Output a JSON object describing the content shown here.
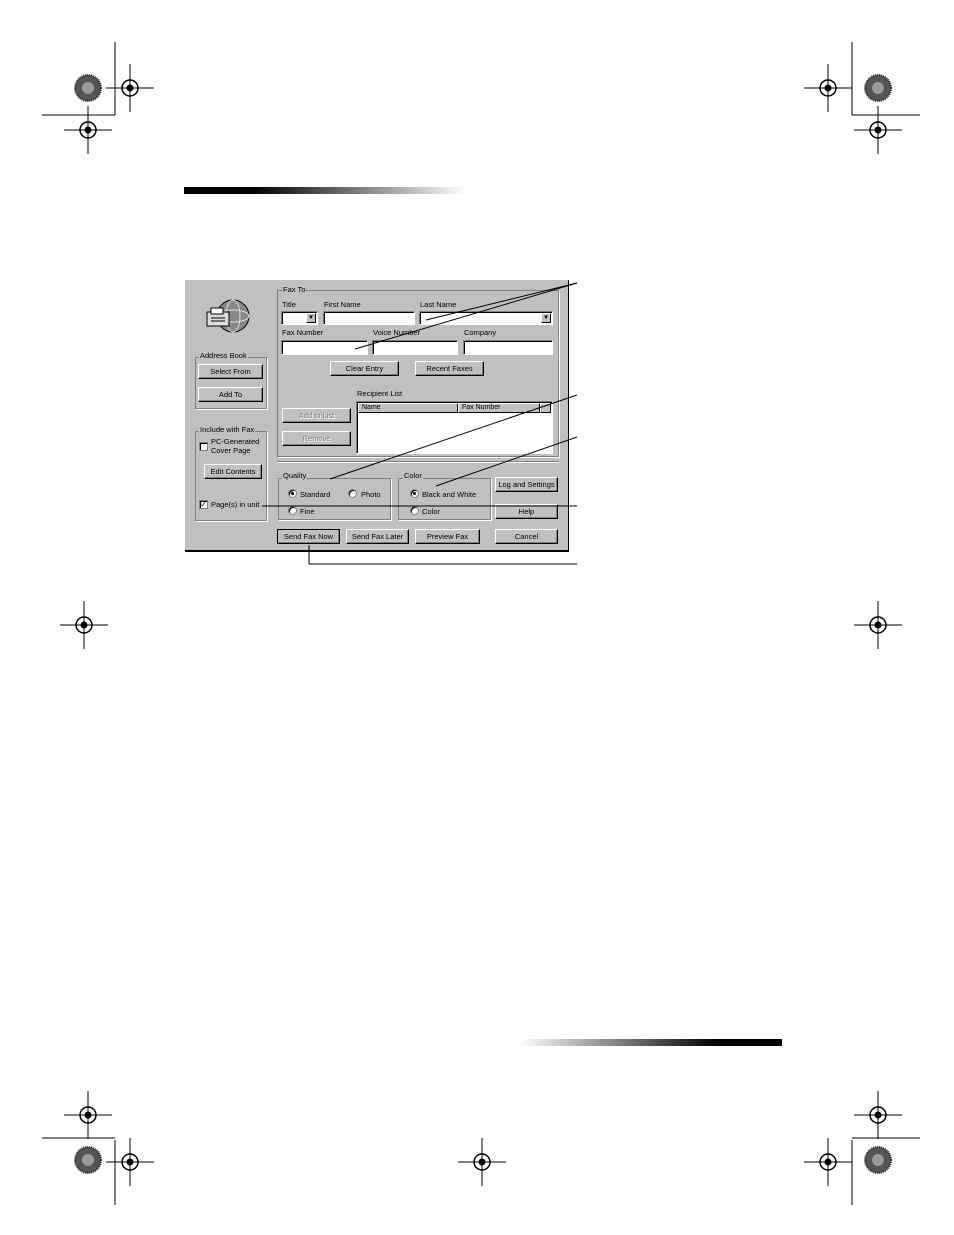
{
  "dialog": {
    "fax_to": {
      "group_label": "Fax To",
      "title_label": "Title",
      "first_name_label": "First Name",
      "last_name_label": "Last Name",
      "fax_number_label": "Fax Number",
      "voice_number_label": "Voice Number",
      "company_label": "Company",
      "clear_entry_button": "Clear Entry",
      "recent_faxes_button": "Recent Faxes",
      "recipient_list_label": "Recipient List",
      "add_to_list_button": "Add to List",
      "remove_button": "Remove",
      "columns": [
        "Name",
        "Fax Number"
      ]
    },
    "address_book": {
      "group_label": "Address Book",
      "select_from_button": "Select From",
      "add_to_button": "Add To"
    },
    "include_with_fax": {
      "group_label": "Include with Fax",
      "cover_page_label_line1": "PC-Generated",
      "cover_page_label_line2": "Cover Page",
      "cover_page_checked": false,
      "edit_contents_button": "Edit Contents",
      "pages_in_unit_label": "Page(s) in unit",
      "pages_in_unit_checked": true
    },
    "quality": {
      "group_label": "Quality",
      "standard_label": "Standard",
      "photo_label": "Photo",
      "fine_label": "Fine",
      "selected": "Standard"
    },
    "color": {
      "group_label": "Color",
      "black_white_label": "Black and White",
      "color_label": "Color",
      "selected": "Black and White"
    },
    "buttons": {
      "log_settings": "Log and Settings",
      "help": "Help",
      "send_now": "Send Fax Now",
      "send_later": "Send Fax Later",
      "preview": "Preview Fax",
      "cancel": "Cancel"
    }
  }
}
